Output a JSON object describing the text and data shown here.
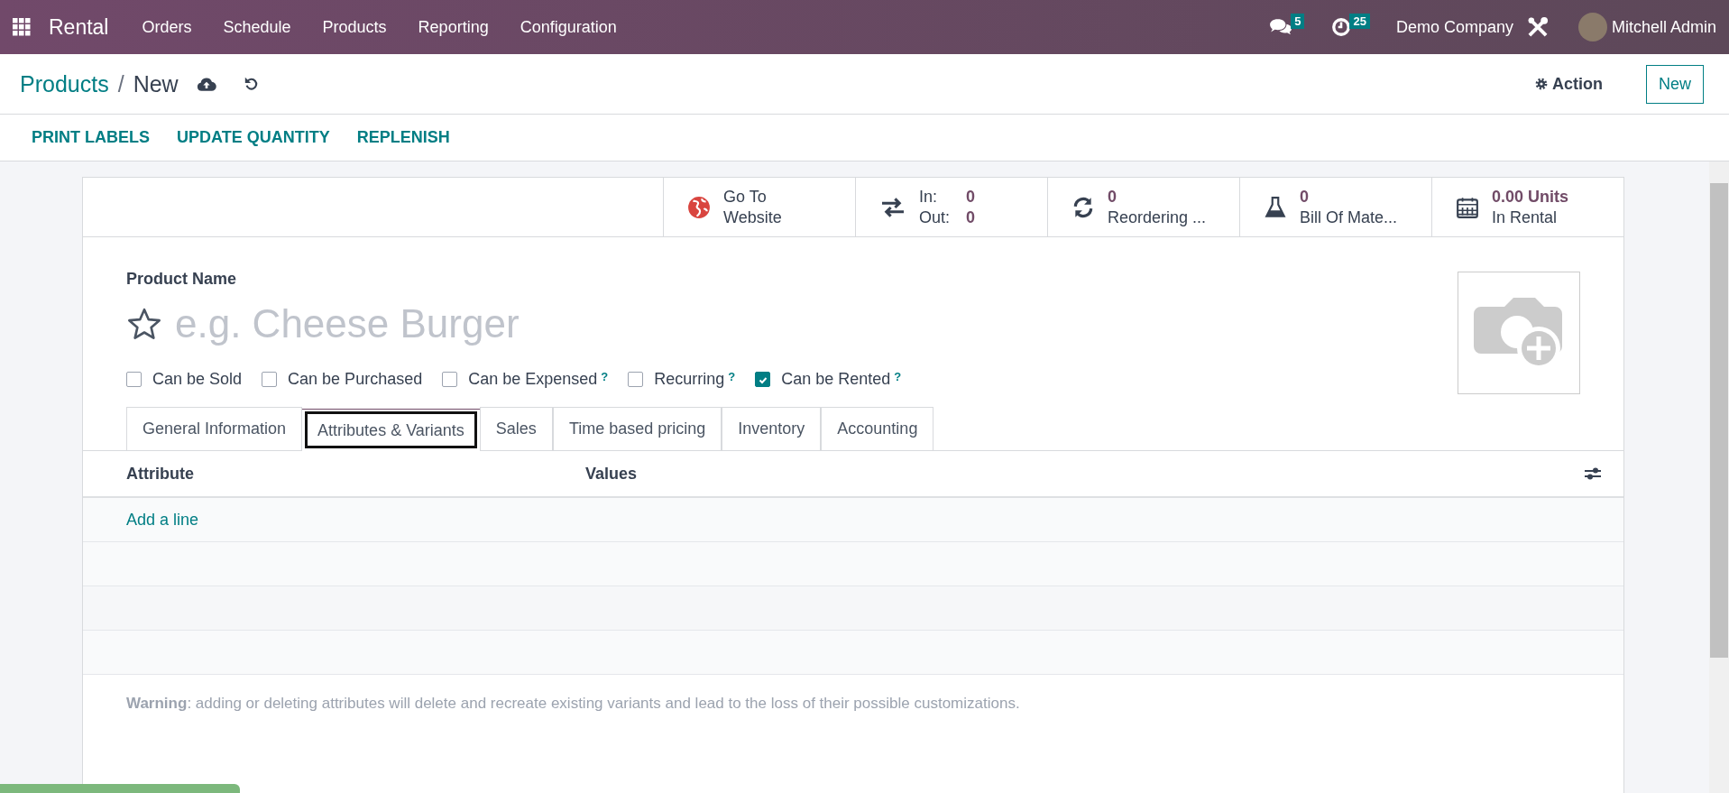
{
  "navbar": {
    "app_name": "Rental",
    "menu": [
      "Orders",
      "Schedule",
      "Products",
      "Reporting",
      "Configuration"
    ],
    "messages_badge": "5",
    "activities_badge": "25",
    "company": "Demo Company",
    "user": "Mitchell Admin"
  },
  "breadcrumb": {
    "parent": "Products",
    "separator": "/",
    "current": "New"
  },
  "action_label": "Action",
  "new_button": "New",
  "toolbar": [
    "PRINT LABELS",
    "UPDATE QUANTITY",
    "REPLENISH"
  ],
  "smart_buttons": [
    {
      "kind": "globe",
      "lines": [
        "Go To",
        "Website"
      ]
    },
    {
      "kind": "transfer",
      "rows": [
        {
          "label": "In:",
          "value": "0"
        },
        {
          "label": "Out:",
          "value": "0"
        }
      ]
    },
    {
      "kind": "refresh",
      "value": "0",
      "label": "Reordering ..."
    },
    {
      "kind": "flask",
      "value": "0",
      "label": "Bill Of Mate..."
    },
    {
      "kind": "calendar",
      "value": "0.00 Units",
      "label": "In Rental"
    }
  ],
  "product": {
    "label": "Product Name",
    "placeholder": "e.g. Cheese Burger",
    "favorite": false
  },
  "options": [
    {
      "label": "Can be Sold",
      "checked": false
    },
    {
      "label": "Can be Purchased",
      "checked": false
    },
    {
      "label": "Can be Expensed",
      "checked": false,
      "help": "?"
    },
    {
      "label": "Recurring",
      "checked": false,
      "help": "?"
    },
    {
      "label": "Can be Rented",
      "checked": true,
      "help": "?"
    }
  ],
  "tabs": [
    {
      "label": "General Information",
      "selected": false
    },
    {
      "label": "Attributes & Variants",
      "selected": true
    },
    {
      "label": "Sales",
      "selected": false
    },
    {
      "label": "Time based pricing",
      "selected": false
    },
    {
      "label": "Inventory",
      "selected": false
    },
    {
      "label": "Accounting",
      "selected": false
    }
  ],
  "table": {
    "columns": [
      "Attribute",
      "Values"
    ],
    "add_line": "Add a line"
  },
  "warning": "**Warning**: adding or deleting attributes will delete and recreate existing variants and lead to the loss of their possible customizations."
}
